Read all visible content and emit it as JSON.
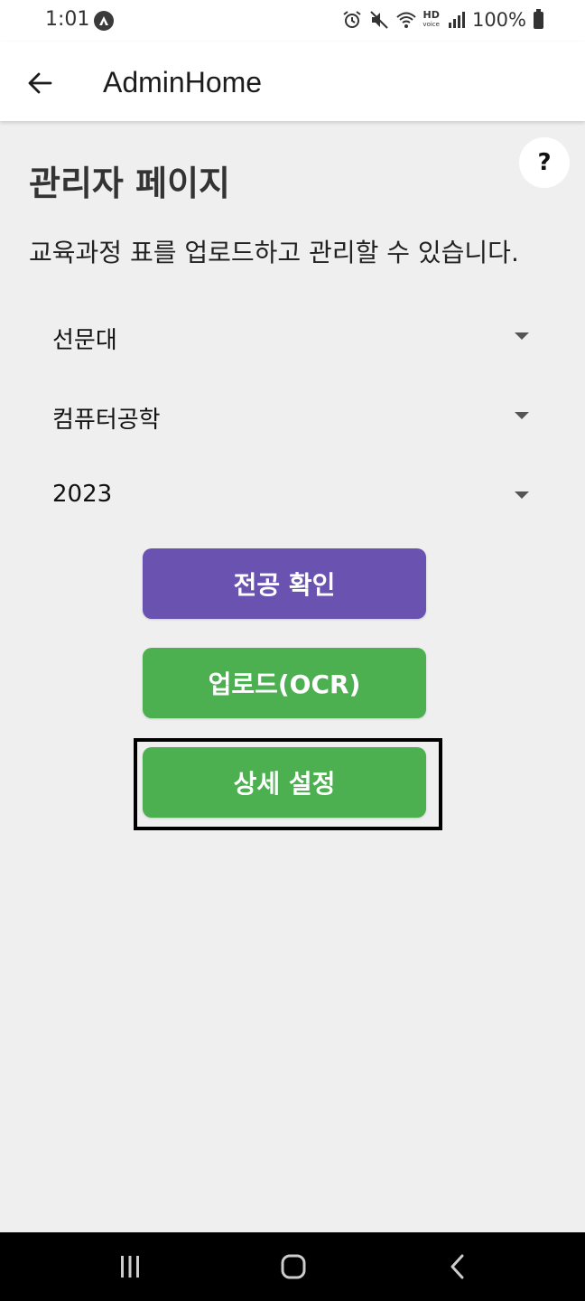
{
  "status_bar": {
    "time": "1:01",
    "battery_text": "100%",
    "hd_label": "HD",
    "hd_sub": "voice",
    "icons": [
      "app-notification-icon",
      "alarm-icon",
      "mute-icon",
      "wifi-icon",
      "hd-voice-icon",
      "signal-icon",
      "battery-icon"
    ]
  },
  "app_bar": {
    "title": "AdminHome",
    "back_icon": "arrow-left-icon"
  },
  "help": {
    "label": "?"
  },
  "page": {
    "heading": "관리자 페이지",
    "description": "교육과정 표를 업로드하고 관리할 수 있습니다."
  },
  "dropdowns": [
    {
      "value": "선문대"
    },
    {
      "value": "컴퓨터공학"
    },
    {
      "value": "2023"
    }
  ],
  "buttons": {
    "check_major": "전공 확인",
    "upload_ocr": "업로드(OCR)",
    "detail_settings": "상세 설정"
  },
  "colors": {
    "purple": "#6a52b0",
    "green": "#4caf50",
    "background": "#efefef"
  },
  "nav_bar": {
    "icons": [
      "recent-apps-icon",
      "home-icon",
      "back-icon"
    ]
  }
}
